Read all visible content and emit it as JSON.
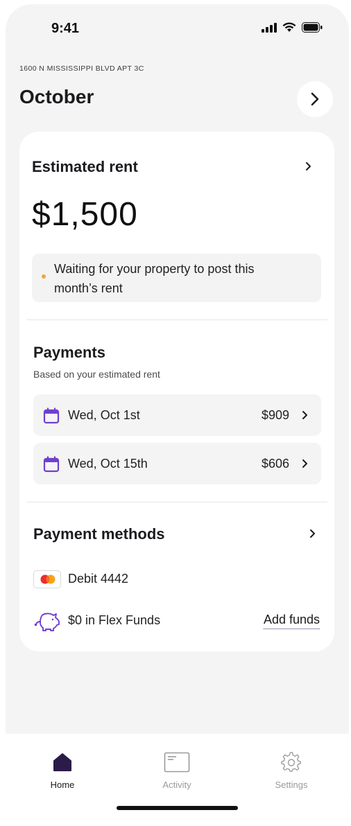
{
  "status_bar": {
    "time": "9:41"
  },
  "header": {
    "address": "1600 N MISSISSIPPI BLVD APT 3C",
    "month": "October"
  },
  "estimated_rent": {
    "title": "Estimated rent",
    "amount": "$1,500",
    "notice_line1": "Waiting for your property to post this",
    "notice_line2": "month’s rent"
  },
  "payments": {
    "title": "Payments",
    "subtitle": "Based on your estimated rent",
    "items": [
      {
        "date": "Wed, Oct 1st",
        "amount": "$909"
      },
      {
        "date": "Wed, Oct 15th",
        "amount": "$606"
      }
    ]
  },
  "payment_methods": {
    "title": "Payment methods",
    "debit_label": "Debit 4442",
    "flex_label": "$0 in Flex Funds",
    "add_funds_label": "Add funds"
  },
  "tabs": [
    {
      "label": "Home",
      "icon": "home-icon",
      "active": true
    },
    {
      "label": "Activity",
      "icon": "activity-icon",
      "active": false
    },
    {
      "label": "Settings",
      "icon": "gear-icon",
      "active": false
    }
  ],
  "colors": {
    "accent": "#3a2760",
    "calendar": "#6f3fd1",
    "warning_dot": "#f0a63a",
    "inactive_tab": "#9a9a9a"
  }
}
